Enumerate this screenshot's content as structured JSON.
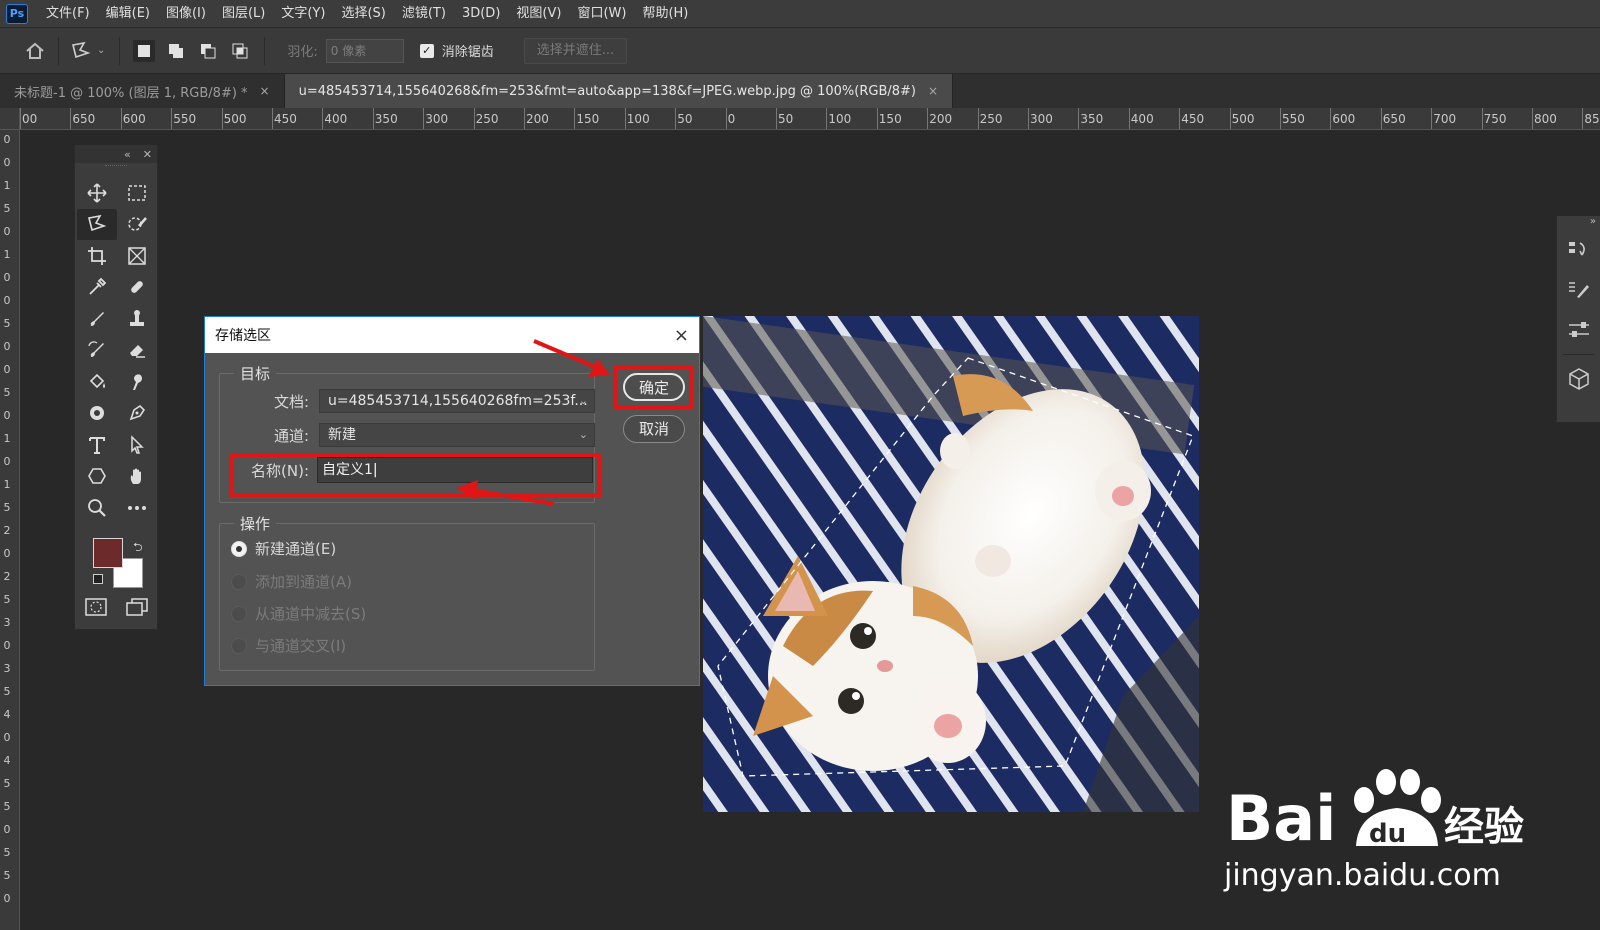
{
  "menubar": {
    "logo": "Ps",
    "items": [
      "文件(F)",
      "编辑(E)",
      "图像(I)",
      "图层(L)",
      "文字(Y)",
      "选择(S)",
      "滤镜(T)",
      "3D(D)",
      "视图(V)",
      "窗口(W)",
      "帮助(H)"
    ]
  },
  "options": {
    "feather_label": "羽化:",
    "feather_value": "0 像素",
    "antialias_label": "消除锯齿",
    "select_mask_label": "选择并遮住..."
  },
  "tabs": [
    {
      "label": "未标题-1 @ 100% (图层 1, RGB/8#) *",
      "close": "×"
    },
    {
      "label": "u=485453714,155640268&fm=253&fmt=auto&app=138&f=JPEG.webp.jpg @ 100%(RGB/8#)",
      "close": "×"
    }
  ],
  "ruler_h": [
    "00",
    "650",
    "600",
    "550",
    "500",
    "450",
    "400",
    "350",
    "300",
    "250",
    "200",
    "150",
    "100",
    "50",
    "0",
    "50",
    "100",
    "150",
    "200",
    "250",
    "300",
    "350",
    "400",
    "450",
    "500",
    "550",
    "600",
    "650",
    "700",
    "750",
    "800",
    "850"
  ],
  "ruler_v": [
    "0",
    "0",
    "1",
    "5",
    "0",
    "1",
    "0",
    "0",
    "5",
    "0",
    "0",
    "5",
    "0",
    "1",
    "0",
    "1",
    "5",
    "2",
    "0",
    "2",
    "5",
    "3",
    "0",
    "3",
    "5",
    "4",
    "0",
    "4",
    "5",
    "5",
    "0",
    "5",
    "5",
    "0"
  ],
  "toolbox": {
    "colors": {
      "foreground": "#6d2a2a",
      "background": "#ffffff"
    }
  },
  "dialog": {
    "title": "存储选区",
    "target_legend": "目标",
    "document_label": "文档:",
    "document_value": "u=485453714,155640268fm=253f...",
    "channel_label": "通道:",
    "channel_value": "新建",
    "name_label": "名称(N):",
    "name_value": "自定义1",
    "operation_legend": "操作",
    "operations": [
      {
        "label": "新建通道(E)",
        "selected": true,
        "enabled": true
      },
      {
        "label": "添加到通道(A)",
        "selected": false,
        "enabled": false
      },
      {
        "label": "从通道中减去(S)",
        "selected": false,
        "enabled": false
      },
      {
        "label": "与通道交叉(I)",
        "selected": false,
        "enabled": false
      }
    ],
    "ok_label": "确定",
    "cancel_label": "取消",
    "close_glyph": "×"
  },
  "watermark": {
    "brand": "Bai",
    "brand_du": "du",
    "brand_cn": "经验",
    "url": "jingyan.baidu.com"
  },
  "colors": {
    "accent_red": "#e01515",
    "dialog_border": "#1e7fd6"
  }
}
